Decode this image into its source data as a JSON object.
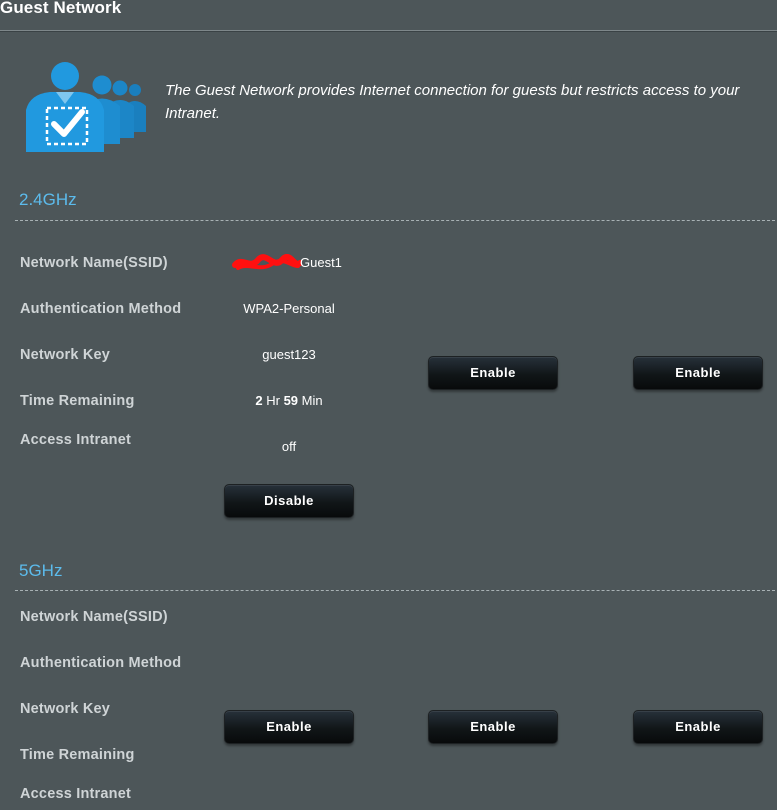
{
  "page": {
    "title": "Guest Network",
    "description": "The Guest Network provides Internet connection for guests but restricts access to your Intranet."
  },
  "icon": {
    "name": "guest-network-icon",
    "color": "#1e8fd4"
  },
  "colors": {
    "background": "#4d5659",
    "band_title": "#5cbbec",
    "label": "#cfd4d6",
    "button": "#111618"
  },
  "band_24": {
    "title": "2.4GHz",
    "labels": {
      "ssid": "Network Name(SSID)",
      "auth": "Authentication Method",
      "key": "Network Key",
      "time": "Time Remaining",
      "intranet": "Access Intranet"
    },
    "profile1": {
      "ssid_suffix": "Guest1",
      "auth": "WPA2-Personal",
      "key": "guest123",
      "time_hours": "2",
      "time_hr_unit": "Hr",
      "time_minutes": "59",
      "time_min_unit": "Min",
      "intranet": "off",
      "button": "Disable"
    },
    "profile2_button": "Enable",
    "profile3_button": "Enable"
  },
  "band_5": {
    "title": "5GHz",
    "labels": {
      "ssid": "Network Name(SSID)",
      "auth": "Authentication Method",
      "key": "Network Key",
      "time": "Time Remaining",
      "intranet": "Access Intranet"
    },
    "profile1_button": "Enable",
    "profile2_button": "Enable",
    "profile3_button": "Enable"
  }
}
